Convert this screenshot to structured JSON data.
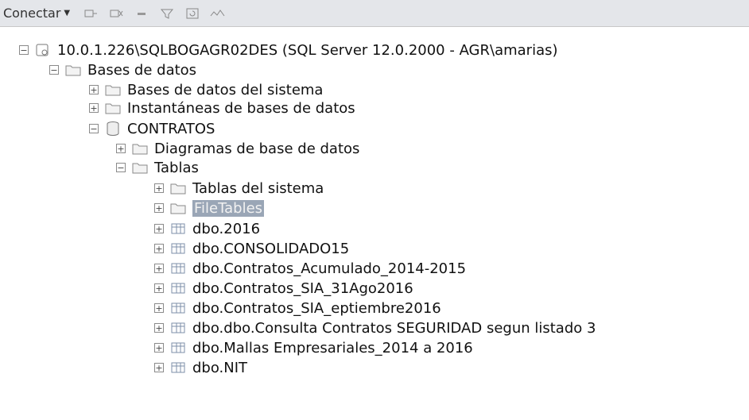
{
  "toolbar": {
    "connect_label": "Conectar",
    "buttons": [
      "connect-icon",
      "disconnect-icon",
      "stop-icon",
      "filter-icon",
      "refresh-icon",
      "activity-monitor-icon"
    ]
  },
  "tree": {
    "server": "10.0.1.226\\SQLBOGAGR02DES (SQL Server 12.0.2000 - AGR\\amarias)",
    "databases_folder": "Bases de datos",
    "system_databases": "Bases de datos del sistema",
    "snapshots": "Instantáneas de bases de datos",
    "database": "CONTRATOS",
    "diagrams": "Diagramas de base de datos",
    "tables_folder": "Tablas",
    "system_tables": "Tablas del sistema",
    "filetables": "FileTables",
    "tables": [
      "dbo.2016",
      "dbo.CONSOLIDADO15",
      "dbo.Contratos_Acumulado_2014-2015",
      "dbo.Contratos_SIA_31Ago2016",
      "dbo.Contratos_SIA_eptiembre2016",
      "dbo.dbo.Consulta Contratos SEGURIDAD segun listado 3",
      "dbo.Mallas Empresariales_2014 a 2016",
      "dbo.NIT"
    ]
  },
  "colors": {
    "selection": "#9aa6b6",
    "folder": "#d9b54a",
    "table": "#8ea8c8"
  }
}
